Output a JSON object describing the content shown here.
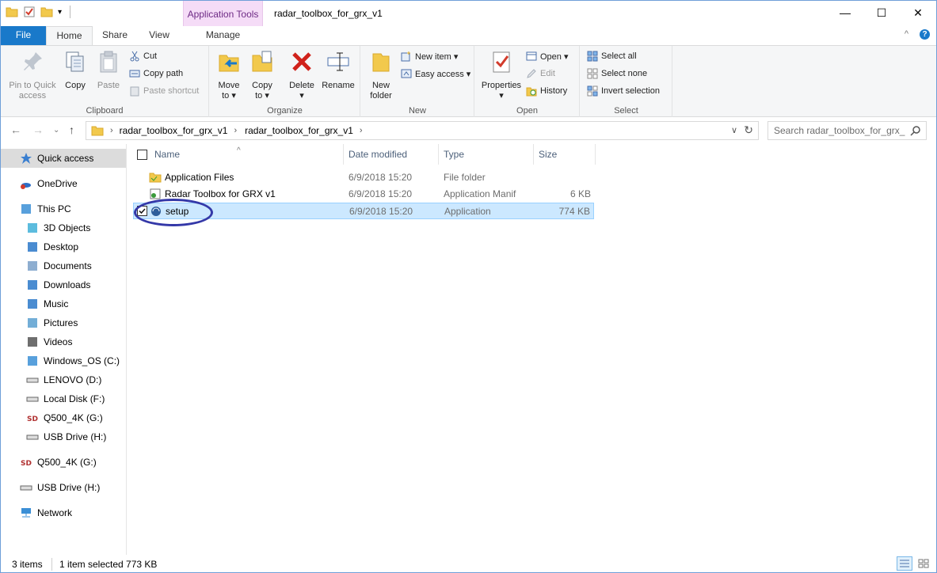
{
  "window": {
    "title": "radar_toolbox_for_grx_v1",
    "context_tab": "Application Tools",
    "controls": {
      "minimize": "—",
      "maximize": "☐",
      "close": "✕"
    }
  },
  "tabs": [
    "File",
    "Home",
    "Share",
    "View",
    "Manage"
  ],
  "ribbon": {
    "clipboard": {
      "label": "Clipboard",
      "pin": [
        "Pin to Quick",
        "access"
      ],
      "copy": "Copy",
      "paste": "Paste",
      "cut": "Cut",
      "copy_path": "Copy path",
      "paste_shortcut": "Paste shortcut"
    },
    "organize": {
      "label": "Organize",
      "move_to": [
        "Move",
        "to ▾"
      ],
      "copy_to": [
        "Copy",
        "to ▾"
      ],
      "delete": [
        "Delete",
        "▾"
      ],
      "rename": "Rename"
    },
    "new": {
      "label": "New",
      "new_folder": [
        "New",
        "folder"
      ],
      "new_item": "New item ▾",
      "easy_access": "Easy access ▾"
    },
    "open": {
      "label": "Open",
      "properties": [
        "Properties",
        "▾"
      ],
      "open": "Open ▾",
      "edit": "Edit",
      "history": "History"
    },
    "select": {
      "label": "Select",
      "select_all": "Select all",
      "select_none": "Select none",
      "invert_selection": "Invert selection"
    }
  },
  "address": {
    "crumbs": [
      "radar_toolbox_for_grx_v1",
      "radar_toolbox_for_grx_v1"
    ],
    "search_placeholder": "Search radar_toolbox_for_grx_"
  },
  "sidebar": {
    "items": [
      {
        "label": "Quick access",
        "icon": "star-icon",
        "active": true
      },
      {
        "label": "OneDrive",
        "icon": "onedrive-icon"
      },
      {
        "label": "This PC",
        "icon": "computer-icon"
      },
      {
        "label": "3D Objects",
        "icon": "cube-icon"
      },
      {
        "label": "Desktop",
        "icon": "desktop-icon"
      },
      {
        "label": "Documents",
        "icon": "documents-icon"
      },
      {
        "label": "Downloads",
        "icon": "downloads-icon"
      },
      {
        "label": "Music",
        "icon": "music-icon"
      },
      {
        "label": "Pictures",
        "icon": "pictures-icon"
      },
      {
        "label": "Videos",
        "icon": "videos-icon"
      },
      {
        "label": "Windows_OS (C:)",
        "icon": "drive-windows-icon"
      },
      {
        "label": "LENOVO (D:)",
        "icon": "drive-icon"
      },
      {
        "label": "Local Disk (F:)",
        "icon": "drive-icon"
      },
      {
        "label": "Q500_4K (G:)",
        "icon": "sd-card-icon"
      },
      {
        "label": "USB Drive (H:)",
        "icon": "usb-drive-icon"
      },
      {
        "label": "Q500_4K (G:)",
        "icon": "sd-card-icon"
      },
      {
        "label": "USB Drive (H:)",
        "icon": "usb-drive-icon"
      },
      {
        "label": "Network",
        "icon": "network-icon"
      }
    ]
  },
  "filelist": {
    "columns": {
      "name": "Name",
      "date": "Date modified",
      "type": "Type",
      "size": "Size"
    },
    "sort_indicator": "^",
    "rows": [
      {
        "name": "Application Files",
        "date": "6/9/2018 15:20",
        "type": "File folder",
        "size": "",
        "icon": "folder-icon",
        "selected": false
      },
      {
        "name": "Radar Toolbox for GRX v1",
        "date": "6/9/2018 15:20",
        "type": "Application Manif",
        "size": "6 KB",
        "icon": "manifest-icon",
        "selected": false
      },
      {
        "name": "setup",
        "date": "6/9/2018 15:20",
        "type": "Application",
        "size": "774 KB",
        "icon": "setup-icon",
        "selected": true
      }
    ]
  },
  "status": {
    "items": "3 items",
    "selection": "1 item selected  773 KB"
  },
  "colors": {
    "file_tab": "#1979ca",
    "context_tab_bg": "#f5dcf7",
    "selection_bg": "#cce8ff",
    "highlight_ellipse": "#3438a8"
  }
}
